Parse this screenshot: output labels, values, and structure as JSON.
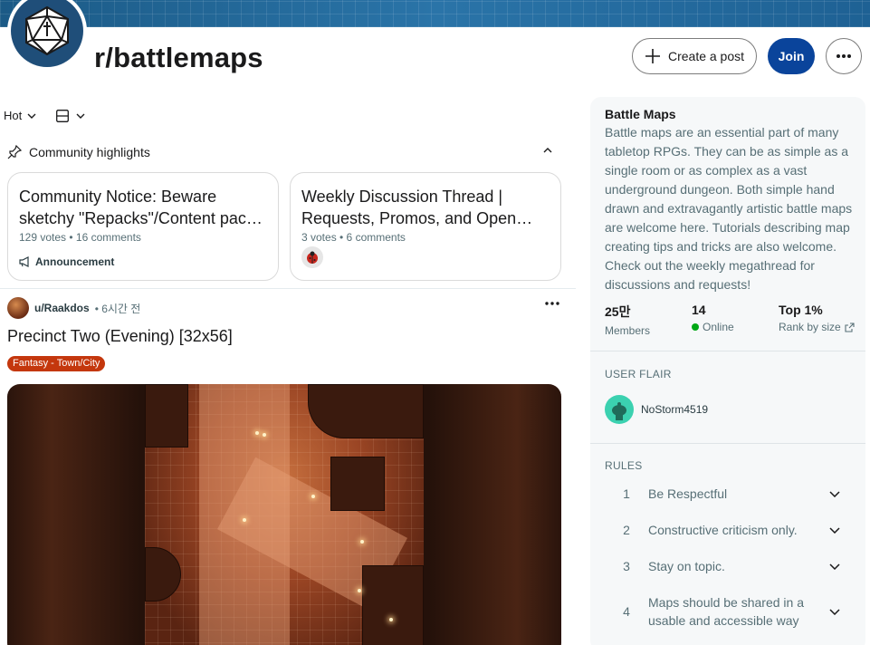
{
  "header": {
    "subreddit_name": "r/battlemaps",
    "create_post_label": "Create a post",
    "join_label": "Join"
  },
  "feed_controls": {
    "sort_label": "Hot"
  },
  "highlights": {
    "heading": "Community highlights",
    "cards": [
      {
        "title": "Community Notice: Beware sketchy \"Repacks\"/Content pac…",
        "title_line1": "Community Notice: Beware",
        "title_line2": "sketchy \"Repacks\"/Content pac…",
        "meta": "129 votes • 16 comments",
        "tag": "Announcement"
      },
      {
        "title": "Weekly Discussion Thread | Requests, Promos, and Open…",
        "title_line1": "Weekly Discussion Thread |",
        "title_line2": "Requests, Promos, and Open…",
        "meta": "3 votes • 6 comments"
      }
    ]
  },
  "post": {
    "author": "u/Raakdos",
    "time": "• 6시간 전",
    "title": "Precinct Two (Evening) [32x56]",
    "flair": "Fantasy - Town/City",
    "flair_color": "#c4370d"
  },
  "sidebar": {
    "name": "Battle Maps",
    "description": "Battle maps are an essential part of many tabletop RPGs. They can be as simple as a single room or as complex as a vast underground dungeon. Both simple hand drawn and extravagantly artistic battle maps are welcome here. Tutorials describing map creating tips and tricks are also welcome. Check out the weekly megathread for discussions and requests!",
    "stats": [
      {
        "value": "25만",
        "label": "Members"
      },
      {
        "value": "14",
        "label": "Online"
      },
      {
        "value": "Top 1%",
        "label": "Rank by size"
      }
    ],
    "user_flair_heading": "USER FLAIR",
    "user_flair_name": "NoStorm4519",
    "rules_heading": "RULES",
    "rules": [
      {
        "num": "1",
        "text": "Be Respectful"
      },
      {
        "num": "2",
        "text": "Constructive criticism only."
      },
      {
        "num": "3",
        "text": "Stay on topic."
      },
      {
        "num": "4",
        "text": "Maps should be shared in a usable and accessible way"
      }
    ]
  },
  "colors": {
    "join_button": "#0a449b",
    "banner": "#2a74a8",
    "online_dot": "#01a816"
  }
}
